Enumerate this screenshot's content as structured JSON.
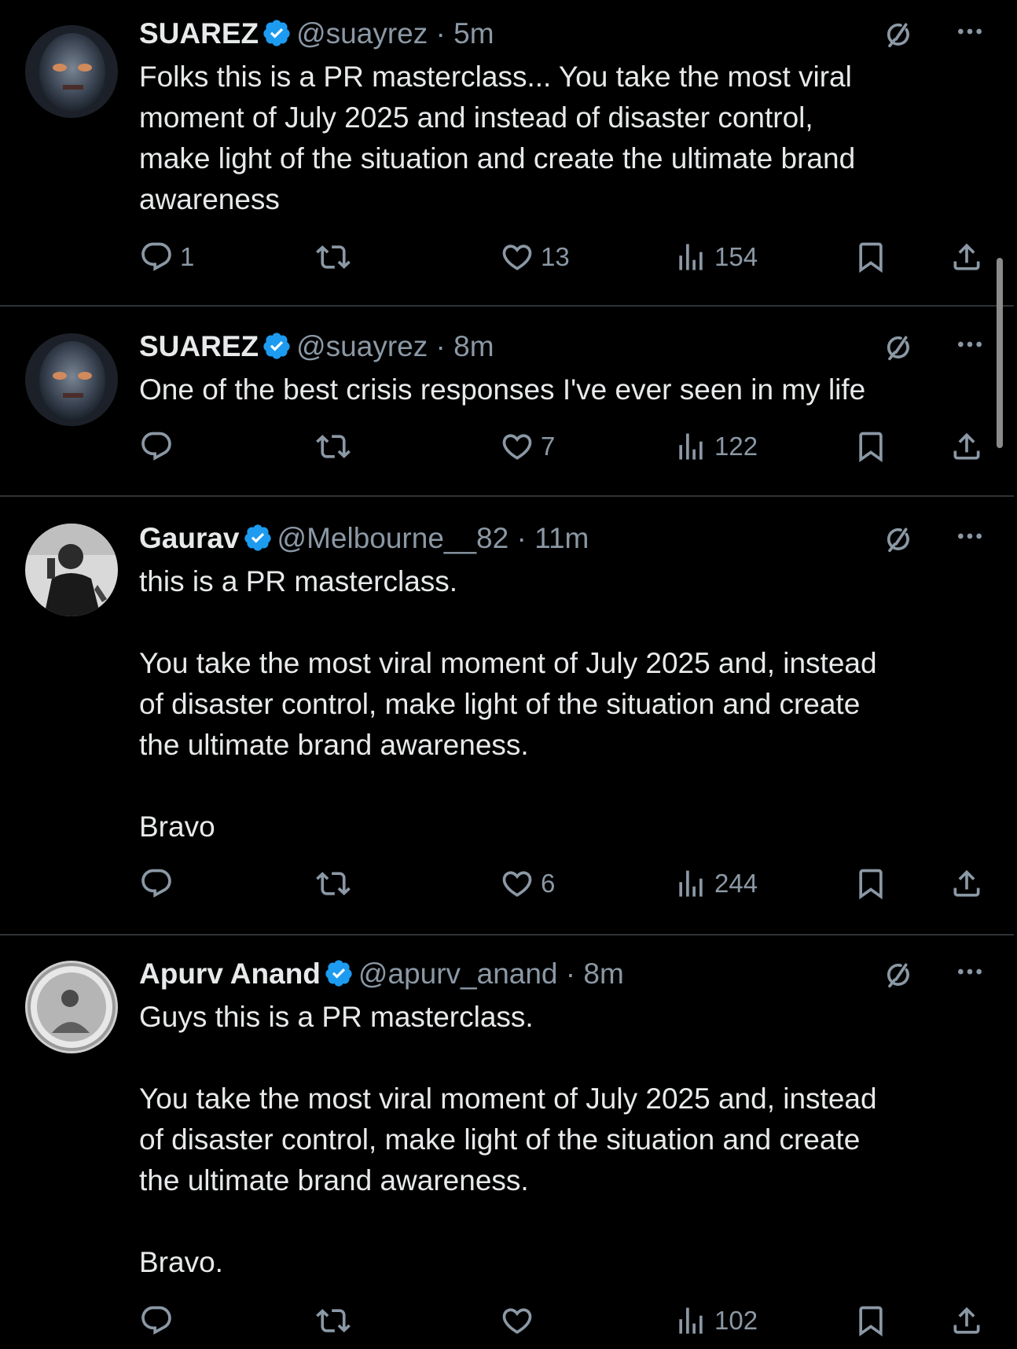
{
  "colors": {
    "background": "#000000",
    "text": "#e7e9ea",
    "secondary": "#8b98a5",
    "divider": "#2f3336",
    "verified": "#1d9bf0"
  },
  "icons": {
    "reply": "reply-icon",
    "retweet": "retweet-icon",
    "like": "heart-icon",
    "views": "views-icon",
    "bookmark": "bookmark-icon",
    "share": "share-icon",
    "grok": "grok-icon",
    "more": "more-icon",
    "verified": "verified-badge-icon"
  },
  "tweets": [
    {
      "name": "SUAREZ",
      "handle": "@suayrez",
      "separator": "·",
      "time": "5m",
      "text": "Folks this is a PR masterclass... You take the most viral\nmoment of July 2025 and instead of disaster control,\nmake light of the situation and create the ultimate brand\nawareness",
      "replies": "1",
      "retweets": "",
      "likes": "13",
      "views": "154"
    },
    {
      "name": "SUAREZ",
      "handle": "@suayrez",
      "separator": "·",
      "time": "8m",
      "text": "One of the best crisis responses I've ever seen in my life",
      "replies": "",
      "retweets": "",
      "likes": "7",
      "views": "122"
    },
    {
      "name": "Gaurav",
      "handle": "@Melbourne__82",
      "separator": "·",
      "time": "11m",
      "text": "this is a PR masterclass.\n\nYou take the most viral moment of July 2025 and, instead\nof disaster control, make light of the situation and create\nthe ultimate brand awareness.\n\nBravo",
      "replies": "",
      "retweets": "",
      "likes": "6",
      "views": "244"
    },
    {
      "name": "Apurv Anand",
      "handle": "@apurv_anand",
      "separator": "·",
      "time": "8m",
      "text": "Guys this is a PR masterclass.\n\nYou take the most viral moment of July 2025 and, instead\nof disaster control, make light of the situation and create\nthe ultimate brand awareness.\n\nBravo.",
      "replies": "",
      "retweets": "",
      "likes": "",
      "views": "102"
    }
  ]
}
